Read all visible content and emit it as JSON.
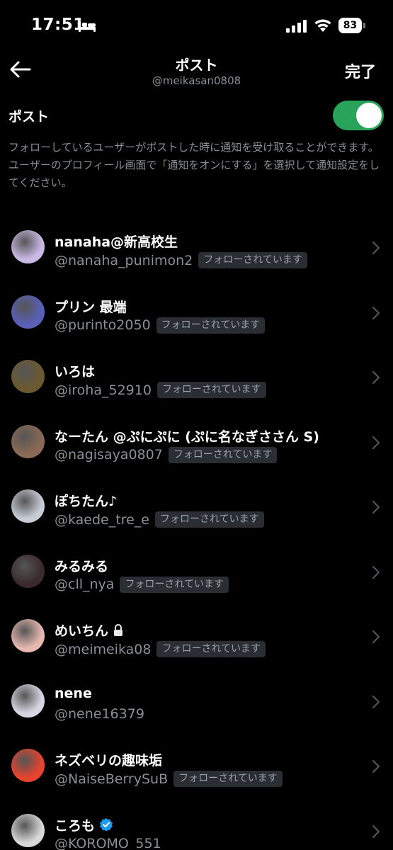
{
  "status_bar": {
    "time": "17:51",
    "battery": "83"
  },
  "header": {
    "title": "ポスト",
    "subtitle": "@meikasan0808",
    "done_label": "完了"
  },
  "setting": {
    "label": "ポスト",
    "enabled": true,
    "description": "フォローしているユーザーがポストした時に通知を受け取ることができます。ユーザーのプロフィール画面で「通知をオンにする」を選択して通知設定をしてください。"
  },
  "colors": {
    "toggle_on": "#27a35a",
    "verified": "#1d9bf0",
    "background": "#000000"
  },
  "users": [
    {
      "name": "nanaha@新高校生",
      "handle": "@nanaha_punimon2",
      "badge": "フォローされています",
      "avatar_color": "#c9b9e6"
    },
    {
      "name": "プリン 最端",
      "handle": "@purinto2050",
      "badge": "フォローされています",
      "avatar_color": "#5a5fb8"
    },
    {
      "name": "いろは",
      "handle": "@iroha_52910",
      "badge": "フォローされています",
      "avatar_color": "#6b5a2f"
    },
    {
      "name": "なーたん @ぷにぷに (ぷに名なぎささん S)",
      "handle": "@nagisaya0807",
      "badge": "フォローされています",
      "avatar_color": "#8a6a55"
    },
    {
      "name": "ぽちたん♪",
      "handle": "@kaede_tre_e",
      "badge": "フォローされています",
      "avatar_color": "#c7ccd6"
    },
    {
      "name": "みるみる",
      "handle": "@cll_nya",
      "badge": "フォローされています",
      "avatar_color": "#3a2a2e"
    },
    {
      "name": "めいちん",
      "handle": "@meimeika08",
      "badge": "フォローされています",
      "avatar_color": "#e6b8b0",
      "locked": true
    },
    {
      "name": "nene",
      "handle": "@nene16379",
      "badge": "",
      "avatar_color": "#d9d6e3"
    },
    {
      "name": "ネズベリの趣味垢",
      "handle": "@NaiseBerrySuB",
      "badge": "フォローされています",
      "avatar_color": "#e8432e"
    },
    {
      "name": "ころも",
      "handle": "@KOROMO_551",
      "badge": "",
      "avatar_color": "#d8d8d8",
      "verified": true
    }
  ]
}
